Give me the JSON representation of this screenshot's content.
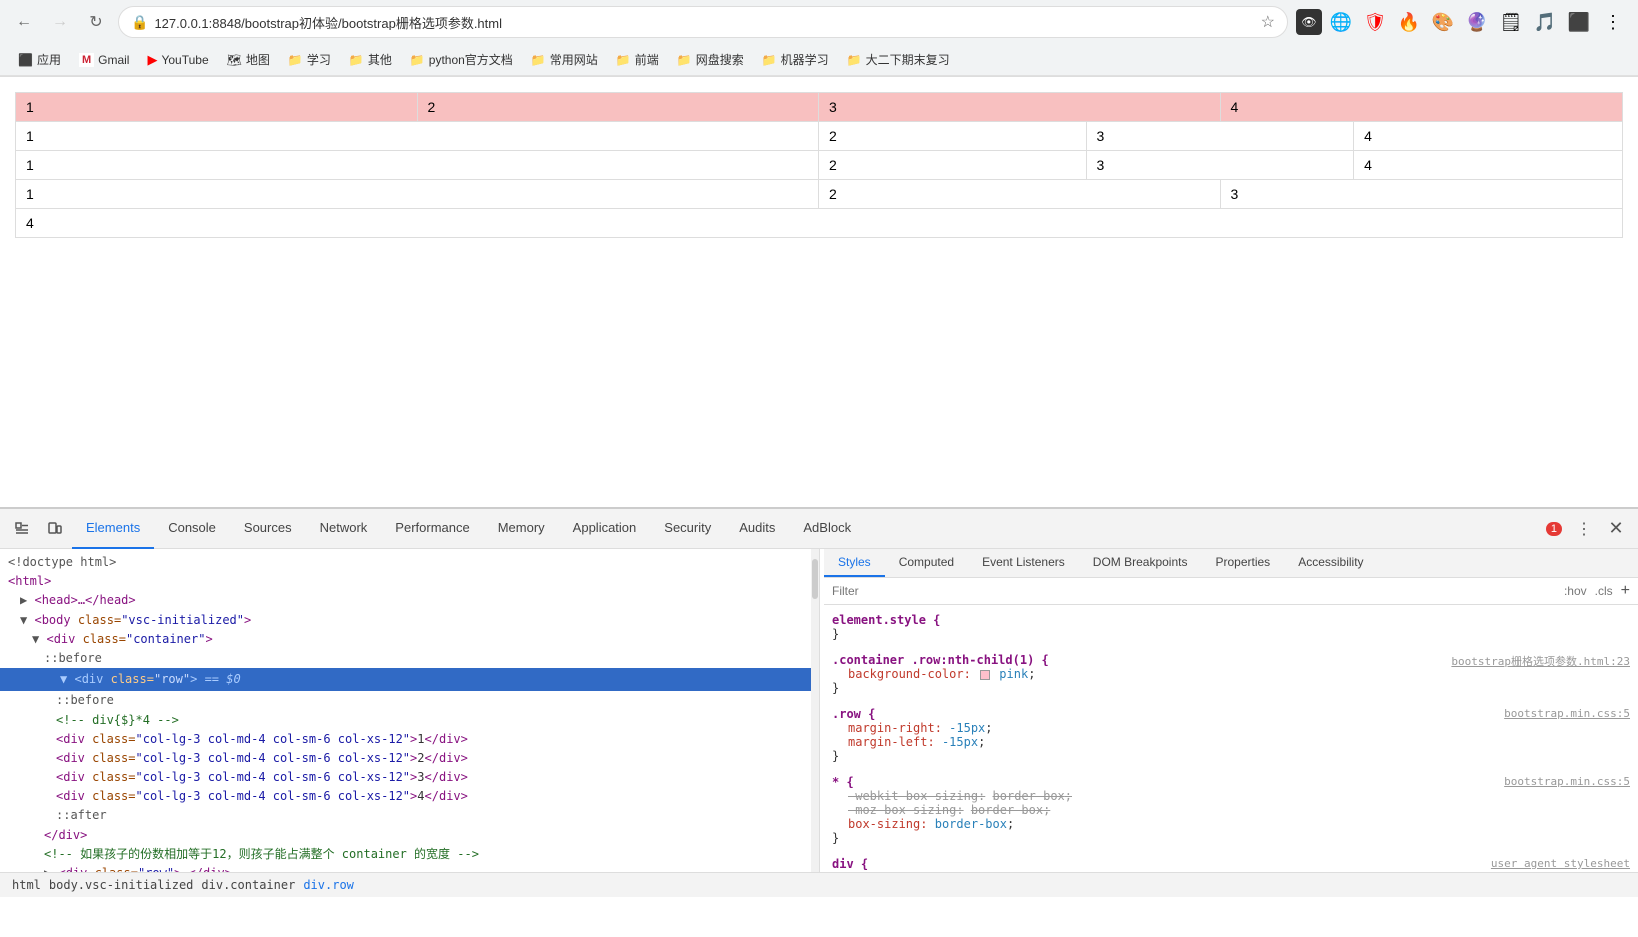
{
  "browser": {
    "url": "127.0.0.1:8848/bootstrap初体验/bootstrap栅格选项参数.html",
    "back_disabled": false,
    "forward_disabled": true
  },
  "bookmarks": [
    {
      "id": "apps",
      "label": "应用",
      "icon": "⬛"
    },
    {
      "id": "gmail",
      "label": "Gmail",
      "icon": "M"
    },
    {
      "id": "youtube",
      "label": "YouTube",
      "icon": "▶"
    },
    {
      "id": "maps",
      "label": "地图",
      "icon": "🗺"
    },
    {
      "id": "xuexi",
      "label": "学习",
      "icon": "📁"
    },
    {
      "id": "qita",
      "label": "其他",
      "icon": "📁"
    },
    {
      "id": "python",
      "label": "python官方文档",
      "icon": "📁"
    },
    {
      "id": "changyong",
      "label": "常用网站",
      "icon": "📁"
    },
    {
      "id": "qianduan",
      "label": "前端",
      "icon": "📁"
    },
    {
      "id": "wangpan",
      "label": "网盘搜索",
      "icon": "📁"
    },
    {
      "id": "jiqixuexi",
      "label": "机器学习",
      "icon": "📁"
    },
    {
      "id": "daner",
      "label": "大二下期末复习",
      "icon": "📁"
    }
  ],
  "grid": {
    "row1": {
      "cells": [
        "1",
        "2",
        "3",
        "4"
      ],
      "widths": [
        "25%",
        "25%",
        "25%",
        "25%"
      ],
      "pink": true
    },
    "row2": {
      "cells": [
        "1",
        "2",
        "3",
        "4"
      ]
    },
    "row3": {
      "cells": [
        "1",
        "2",
        "3",
        "4"
      ]
    },
    "row4": {
      "cells": [
        "1",
        "2",
        "3"
      ]
    },
    "row5": {
      "cells": [
        "4"
      ]
    }
  },
  "devtools": {
    "tabs": [
      {
        "id": "elements",
        "label": "Elements",
        "active": true
      },
      {
        "id": "console",
        "label": "Console"
      },
      {
        "id": "sources",
        "label": "Sources"
      },
      {
        "id": "network",
        "label": "Network"
      },
      {
        "id": "performance",
        "label": "Performance"
      },
      {
        "id": "memory",
        "label": "Memory"
      },
      {
        "id": "application",
        "label": "Application"
      },
      {
        "id": "security",
        "label": "Security"
      },
      {
        "id": "audits",
        "label": "Audits"
      },
      {
        "id": "adblock",
        "label": "AdBlock"
      }
    ],
    "error_count": "1",
    "html_lines": [
      {
        "indent": 0,
        "content": "<!doctype html>"
      },
      {
        "indent": 0,
        "content": "<html>"
      },
      {
        "indent": 1,
        "content": "▶ <head>…</head>"
      },
      {
        "indent": 1,
        "content": "▼ <body class=\"vsc-initialized\">"
      },
      {
        "indent": 2,
        "content": "▼ <div class=\"container\">"
      },
      {
        "indent": 3,
        "content": "::before"
      },
      {
        "indent": 3,
        "content": "▼ <div class=\"row\"> == $0",
        "selected": true
      },
      {
        "indent": 4,
        "content": "::before"
      },
      {
        "indent": 4,
        "content": "<!-- div{$}*4 -->"
      },
      {
        "indent": 4,
        "content": "<div class=\"col-lg-3 col-md-4 col-sm-6 col-xs-12\">1</div>"
      },
      {
        "indent": 4,
        "content": "<div class=\"col-lg-3 col-md-4 col-sm-6 col-xs-12\">2</div>"
      },
      {
        "indent": 4,
        "content": "<div class=\"col-lg-3 col-md-4 col-sm-6 col-xs-12\">3</div>"
      },
      {
        "indent": 4,
        "content": "<div class=\"col-lg-3 col-md-4 col-sm-6 col-xs-12\">4</div>"
      },
      {
        "indent": 4,
        "content": "::after"
      },
      {
        "indent": 3,
        "content": "</div>"
      },
      {
        "indent": 3,
        "content": "<!-- 如果孩子的份数相加等于12，则孩子能占满整个 container 的宽度 -->"
      },
      {
        "indent": 3,
        "content": "▶ <div class=\"row\">…</div>"
      }
    ],
    "breadcrumbs": [
      "html",
      "body.vsc-initialized",
      "div.container",
      "div.row"
    ]
  },
  "styles_panel": {
    "filter_placeholder": "Filter",
    "hov_label": ":hov",
    "cls_label": ".cls",
    "plus_label": "+",
    "sections": [
      {
        "selector": "element.style {",
        "closing": "}",
        "source": "",
        "properties": []
      },
      {
        "selector": ".container .row:nth-child(1) {",
        "closing": "}",
        "source": "bootstrap栅格选项参数.html:23",
        "properties": [
          {
            "name": "background-color:",
            "value": "pink",
            "has_swatch": true
          }
        ]
      },
      {
        "selector": ".row {",
        "closing": "}",
        "source": "bootstrap.min.css:5",
        "properties": [
          {
            "name": "margin-right:",
            "value": "-15px"
          },
          {
            "name": "margin-left:",
            "value": "-15px"
          }
        ]
      },
      {
        "selector": "* {",
        "closing": "}",
        "source": "bootstrap.min.css:5",
        "properties": [
          {
            "name": "-webkit-box-sizing:",
            "value": "border-box",
            "strikethrough": true
          },
          {
            "name": "-moz-box-sizing:",
            "value": "border-box",
            "strikethrough": true
          },
          {
            "name": "box-sizing:",
            "value": "border-box"
          }
        ]
      },
      {
        "selector": "div {",
        "closing": "",
        "source": "user agent stylesheet",
        "properties": []
      }
    ]
  },
  "right_panel_tabs": [
    {
      "id": "styles",
      "label": "Styles",
      "active": true
    },
    {
      "id": "computed",
      "label": "Computed"
    },
    {
      "id": "event-listeners",
      "label": "Event Listeners"
    },
    {
      "id": "dom-breakpoints",
      "label": "DOM Breakpoints"
    },
    {
      "id": "properties",
      "label": "Properties"
    },
    {
      "id": "accessibility",
      "label": "Accessibility"
    }
  ]
}
